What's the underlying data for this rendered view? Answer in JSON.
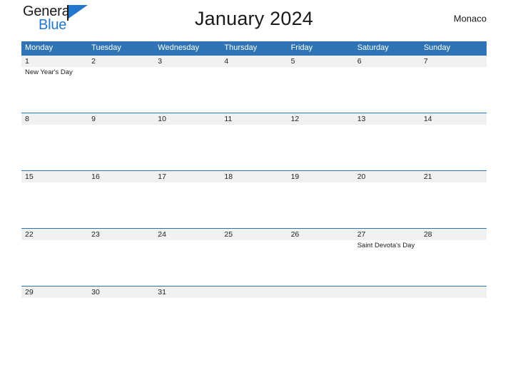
{
  "brand": {
    "name_top": "General",
    "name_bottom": "Blue",
    "accent_color": "#2277cc"
  },
  "header": {
    "title": "January 2024",
    "locale": "Monaco"
  },
  "theme": {
    "header_blue": "#2e74b5",
    "row_band_gray": "#f1f1f1",
    "text_dark": "#222222"
  },
  "calendar": {
    "weekday_headers": [
      "Monday",
      "Tuesday",
      "Wednesday",
      "Thursday",
      "Friday",
      "Saturday",
      "Sunday"
    ],
    "weeks": [
      {
        "days": [
          {
            "num": "1",
            "event": "New Year's Day"
          },
          {
            "num": "2",
            "event": ""
          },
          {
            "num": "3",
            "event": ""
          },
          {
            "num": "4",
            "event": ""
          },
          {
            "num": "5",
            "event": ""
          },
          {
            "num": "6",
            "event": ""
          },
          {
            "num": "7",
            "event": ""
          }
        ]
      },
      {
        "days": [
          {
            "num": "8",
            "event": ""
          },
          {
            "num": "9",
            "event": ""
          },
          {
            "num": "10",
            "event": ""
          },
          {
            "num": "11",
            "event": ""
          },
          {
            "num": "12",
            "event": ""
          },
          {
            "num": "13",
            "event": ""
          },
          {
            "num": "14",
            "event": ""
          }
        ]
      },
      {
        "days": [
          {
            "num": "15",
            "event": ""
          },
          {
            "num": "16",
            "event": ""
          },
          {
            "num": "17",
            "event": ""
          },
          {
            "num": "18",
            "event": ""
          },
          {
            "num": "19",
            "event": ""
          },
          {
            "num": "20",
            "event": ""
          },
          {
            "num": "21",
            "event": ""
          }
        ]
      },
      {
        "days": [
          {
            "num": "22",
            "event": ""
          },
          {
            "num": "23",
            "event": ""
          },
          {
            "num": "24",
            "event": ""
          },
          {
            "num": "25",
            "event": ""
          },
          {
            "num": "26",
            "event": ""
          },
          {
            "num": "27",
            "event": "Saint Devota's Day"
          },
          {
            "num": "28",
            "event": ""
          }
        ]
      },
      {
        "days": [
          {
            "num": "29",
            "event": ""
          },
          {
            "num": "30",
            "event": ""
          },
          {
            "num": "31",
            "event": ""
          },
          {
            "num": "",
            "event": ""
          },
          {
            "num": "",
            "event": ""
          },
          {
            "num": "",
            "event": ""
          },
          {
            "num": "",
            "event": ""
          }
        ]
      }
    ]
  }
}
